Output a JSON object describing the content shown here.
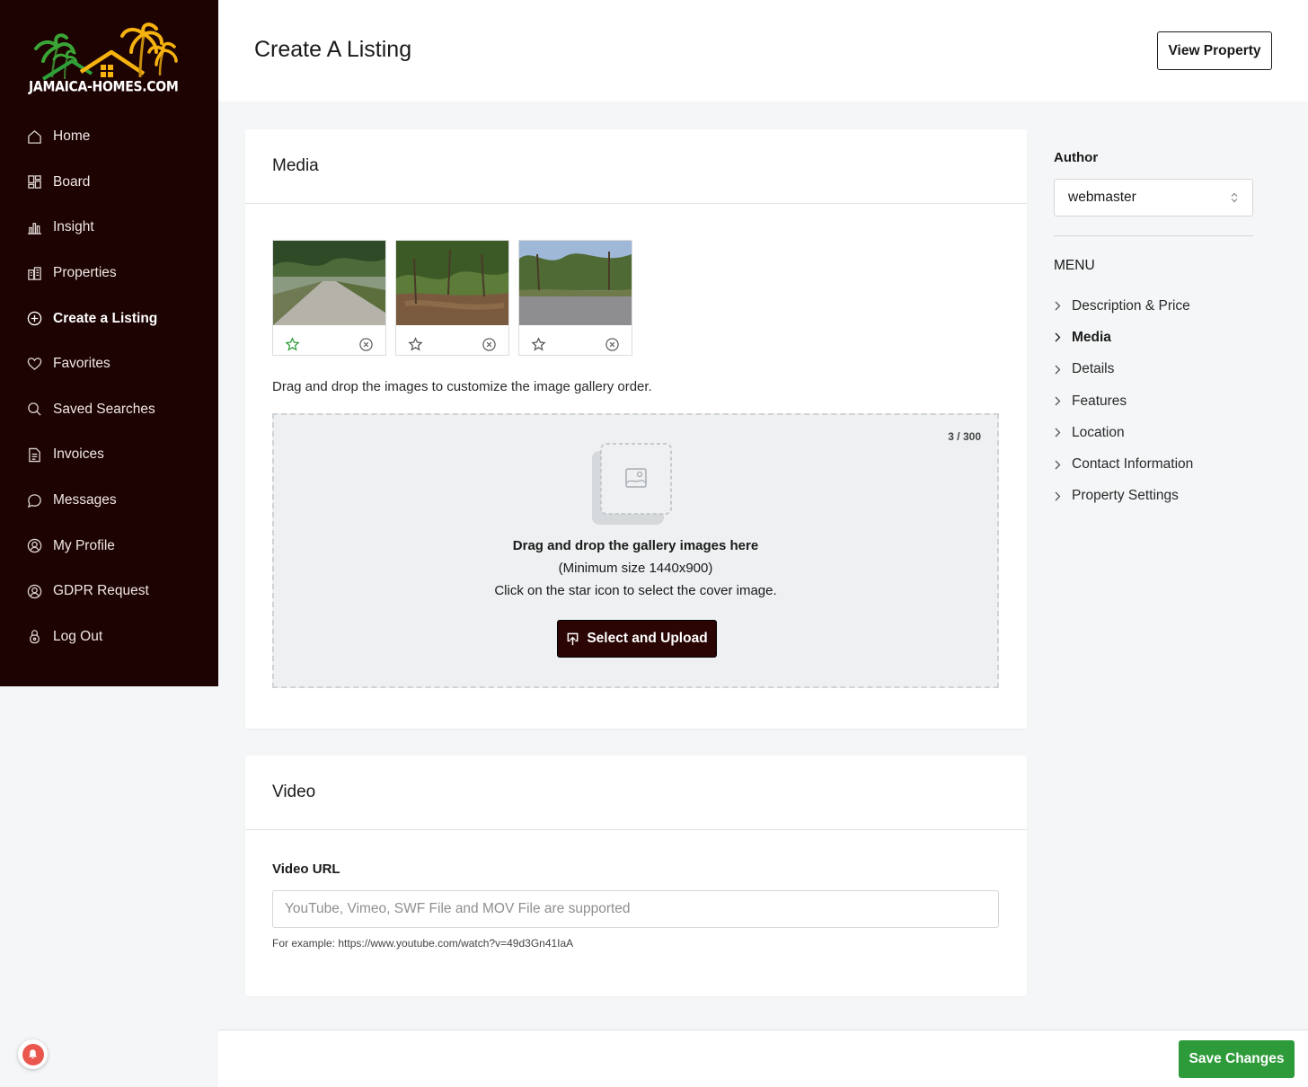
{
  "brand": {
    "name": "JAMAICA-HOMES.COM"
  },
  "sidebar": {
    "items": [
      {
        "label": "Home",
        "icon": "home-icon"
      },
      {
        "label": "Board",
        "icon": "board-icon"
      },
      {
        "label": "Insight",
        "icon": "insight-icon"
      },
      {
        "label": "Properties",
        "icon": "properties-icon"
      },
      {
        "label": "Create a Listing",
        "icon": "plus-circle-icon",
        "active": true
      },
      {
        "label": "Favorites",
        "icon": "heart-icon"
      },
      {
        "label": "Saved Searches",
        "icon": "search-icon"
      },
      {
        "label": "Invoices",
        "icon": "invoice-icon"
      },
      {
        "label": "Messages",
        "icon": "message-icon"
      },
      {
        "label": "My Profile",
        "icon": "profile-icon"
      },
      {
        "label": "GDPR Request",
        "icon": "gdpr-icon"
      },
      {
        "label": "Log Out",
        "icon": "lock-icon"
      }
    ]
  },
  "header": {
    "title": "Create A Listing",
    "view_property_label": "View Property"
  },
  "media": {
    "section_title": "Media",
    "drag_hint": "Drag and drop the images to customize the image gallery order.",
    "dropzone": {
      "count": "3 / 300",
      "title": "Drag and drop the gallery images here",
      "line1": "(Minimum size 1440x900)",
      "line2": "Click on the star icon to select the cover image.",
      "upload_label": "Select and Upload"
    }
  },
  "video": {
    "section_title": "Video",
    "field_label": "Video URL",
    "placeholder": "YouTube, Vimeo, SWF File and MOV File are supported",
    "value": "",
    "help": "For example: https://www.youtube.com/watch?v=49d3Gn41IaA"
  },
  "right_panel": {
    "author_label": "Author",
    "author_value": "webmaster",
    "menu_title": "MENU",
    "menu": [
      {
        "label": "Description & Price"
      },
      {
        "label": "Media",
        "active": true
      },
      {
        "label": "Details"
      },
      {
        "label": "Features"
      },
      {
        "label": "Location"
      },
      {
        "label": "Contact Information"
      },
      {
        "label": "Property Settings"
      }
    ]
  },
  "footer": {
    "save_label": "Save Changes"
  },
  "colors": {
    "sidebar_bg": "#1d0302",
    "upload_button": "#2a0504",
    "save_button": "#2e9b3a",
    "star_green": "#2e9b3a",
    "notification": "#e9574e"
  }
}
